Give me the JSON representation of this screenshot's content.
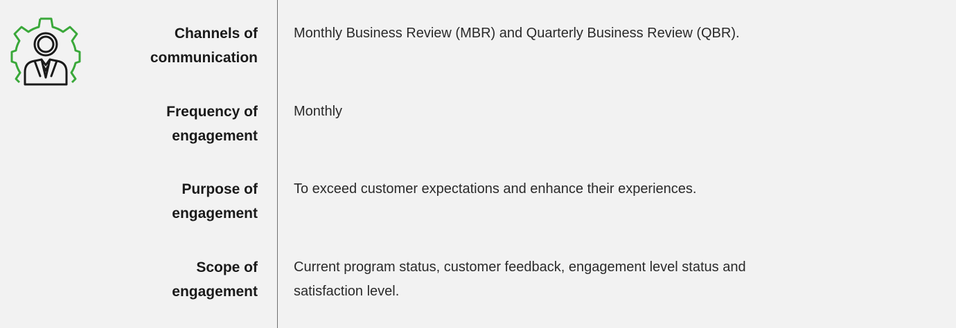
{
  "icon": {
    "name": "customer-service-gear-icon",
    "gear_color": "#3aa83a",
    "person_color": "#1a1a1a"
  },
  "colors": {
    "background": "#f2f2f2",
    "divider": "#6e6e6e",
    "text": "#1a1a1a"
  },
  "rows": [
    {
      "label": "Channels of\ncommunication",
      "value": "Monthly Business Review (MBR) and Quarterly Business Review (QBR)."
    },
    {
      "label": "Frequency of\nengagement",
      "value": "Monthly"
    },
    {
      "label": "Purpose of\nengagement",
      "value": "To exceed customer expectations and enhance their experiences."
    },
    {
      "label": "Scope of\nengagement",
      "value": "Current program status, customer feedback, engagement level status and\nsatisfaction level."
    }
  ]
}
